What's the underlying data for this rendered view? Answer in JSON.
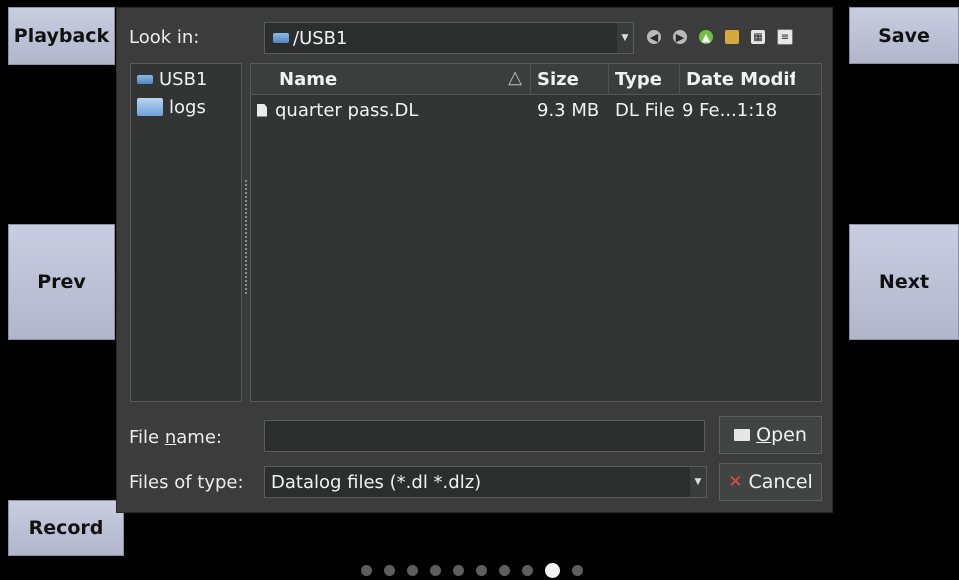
{
  "side_buttons": {
    "playback": "Playback",
    "prev": "Prev",
    "record": "Record",
    "save": "Save",
    "next": "Next"
  },
  "dialog": {
    "look_in_label": "Look in:",
    "look_in_value": "/USB1",
    "toolbar_icons": [
      "back-icon",
      "forward-icon",
      "up-icon",
      "new-folder-icon",
      "detail-view-icon",
      "list-view-icon"
    ],
    "sidebar": [
      {
        "label": "USB1",
        "icon": "drive-icon"
      },
      {
        "label": "logs",
        "icon": "folder-icon"
      }
    ],
    "columns": {
      "name": "Name",
      "size": "Size",
      "type": "Type",
      "date": "Date Modif"
    },
    "sort_indicator": "△",
    "files": [
      {
        "name": "quarter pass.DL",
        "size": "9.3 MB",
        "type": "DL File",
        "date": "9 Fe...1:18"
      }
    ],
    "file_name_label_pre": "File ",
    "file_name_label_u": "n",
    "file_name_label_post": "ame:",
    "file_name_value": "",
    "files_of_type_label": "Files of type:",
    "files_of_type_value": "Datalog files (*.dl *.dlz)",
    "open_label_u": "O",
    "open_label_rest": "pen",
    "cancel_label": "Cancel"
  },
  "page_indicator": {
    "total": 10,
    "active_index": 8
  }
}
